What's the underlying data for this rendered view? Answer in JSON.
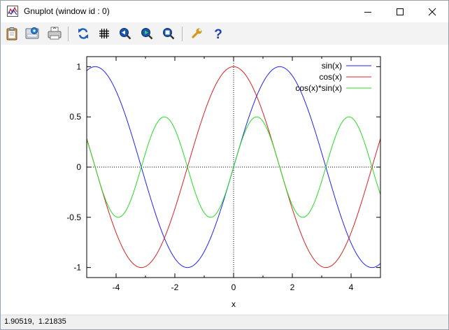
{
  "window": {
    "title": "Gnuplot (window id : 0)"
  },
  "toolbar": {
    "buttons": [
      {
        "name": "copy-to-clipboard",
        "icon": "clipboard-icon"
      },
      {
        "name": "save",
        "icon": "save-icon"
      },
      {
        "name": "print",
        "icon": "printer-icon"
      },
      {
        "name": "replot",
        "icon": "replot-icon"
      },
      {
        "name": "grid",
        "icon": "grid-icon"
      },
      {
        "name": "zoom-previous",
        "icon": "zoom-previous-icon"
      },
      {
        "name": "zoom-next",
        "icon": "zoom-next-icon"
      },
      {
        "name": "unzoom",
        "icon": "unzoom-icon"
      },
      {
        "name": "options",
        "icon": "wrench-icon"
      },
      {
        "name": "help",
        "icon": "help-icon"
      }
    ]
  },
  "status": {
    "coordinates": "1.90519,  1.21835"
  },
  "chart_data": {
    "type": "line",
    "title": "",
    "xlabel": "x",
    "ylabel": "",
    "xlim": [
      -5,
      5
    ],
    "ylim": [
      -1.1,
      1.1
    ],
    "xticks": [
      -4,
      -2,
      0,
      2,
      4
    ],
    "xtick_labels": [
      "-4",
      "-2",
      "0",
      "2",
      "4"
    ],
    "yticks": [
      -1,
      -0.5,
      0,
      0.5,
      1
    ],
    "ytick_labels": [
      "-1",
      "-0.5",
      "0",
      "0.5",
      "1"
    ],
    "zero_axes": true,
    "legend_position": "top-right",
    "series": [
      {
        "name": "sin(x)",
        "function": "sin",
        "color": "#2020ff"
      },
      {
        "name": "cos(x)",
        "function": "cos",
        "color": "#e02020"
      },
      {
        "name": "cos(x)*sin(x)",
        "function": "cossin",
        "color": "#20e020"
      }
    ]
  }
}
